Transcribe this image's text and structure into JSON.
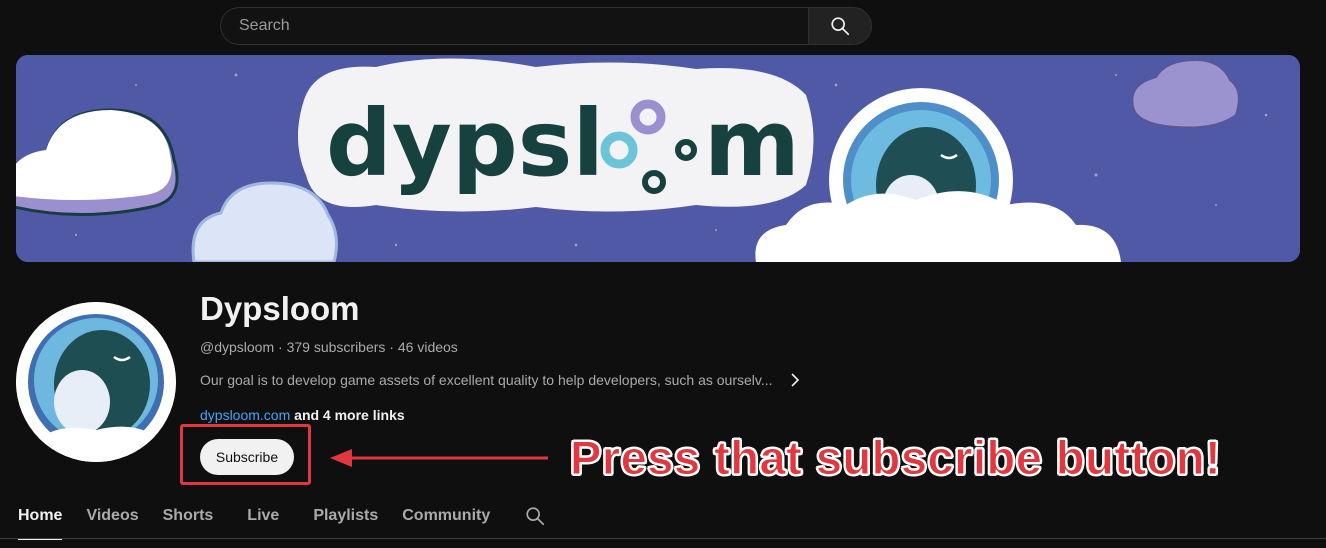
{
  "search": {
    "placeholder": "Search",
    "value": ""
  },
  "banner": {
    "logo_text": "dypsloom",
    "background_color": "#4f5aa3"
  },
  "channel": {
    "name": "Dypsloom",
    "handle": "@dypsloom",
    "subscribers": "379 subscribers",
    "videos": "46 videos",
    "separator": " · ",
    "description": "Our goal is to develop game assets of excellent quality to help developers, such as ourselv...",
    "link": "dypsloom.com",
    "more_links": " and 4 more links",
    "subscribe_label": "Subscribe"
  },
  "annotation": {
    "callout_text": "Press that subscribe button!",
    "color": "#e0383e"
  },
  "tabs": [
    {
      "label": "Home",
      "active": true
    },
    {
      "label": "Videos",
      "active": false
    },
    {
      "label": "Shorts",
      "active": false
    },
    {
      "label": "Live",
      "active": false
    },
    {
      "label": "Playlists",
      "active": false
    },
    {
      "label": "Community",
      "active": false
    }
  ],
  "icons": {
    "search": "search-icon",
    "chevron": "chevron-right-icon",
    "tab_search": "search-icon"
  }
}
